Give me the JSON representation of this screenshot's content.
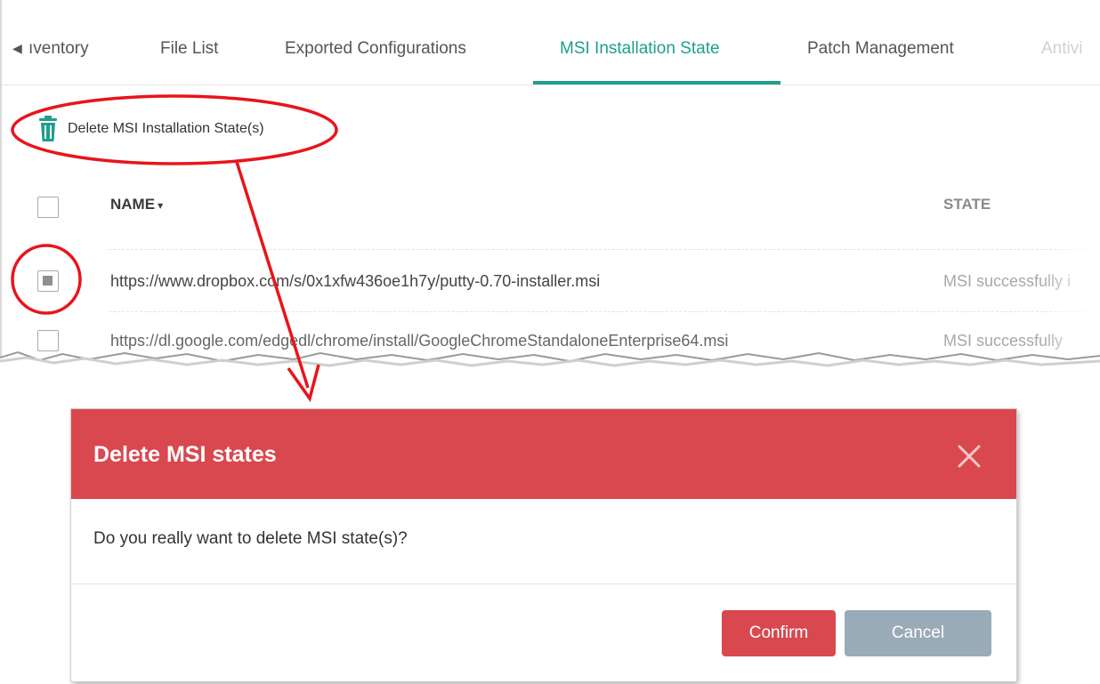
{
  "tabs": {
    "scroll_left": "◀",
    "items": [
      {
        "label": "ıventory"
      },
      {
        "label": "File List"
      },
      {
        "label": "Exported Configurations"
      },
      {
        "label": "MSI Installation State"
      },
      {
        "label": "Patch Management"
      },
      {
        "label": "Antivi"
      }
    ],
    "active_index": 3
  },
  "toolbar": {
    "delete_label": "Delete MSI Installation State(s)",
    "delete_icon": "trash-icon"
  },
  "table": {
    "headers": {
      "name": "NAME",
      "sort_indicator": "▾",
      "state": "STATE"
    },
    "rows": [
      {
        "checked": true,
        "name": "https://www.dropbox.com/s/0x1xfw436oe1h7y/putty-0.70-installer.msi",
        "state": "MSI successfully i"
      },
      {
        "checked": false,
        "name": "https://dl.google.com/edgedl/chrome/install/GoogleChromeStandaloneEnterprise64.msi",
        "state": "MSI successfully"
      }
    ]
  },
  "modal": {
    "title": "Delete MSI states",
    "message": "Do you really want to delete MSI state(s)?",
    "confirm_label": "Confirm",
    "cancel_label": "Cancel",
    "header_color": "#d9484f"
  },
  "colors": {
    "accent": "#1f9f8b",
    "danger": "#d9484f",
    "annotation": "#e8141c",
    "cancel": "#9aabb8"
  }
}
